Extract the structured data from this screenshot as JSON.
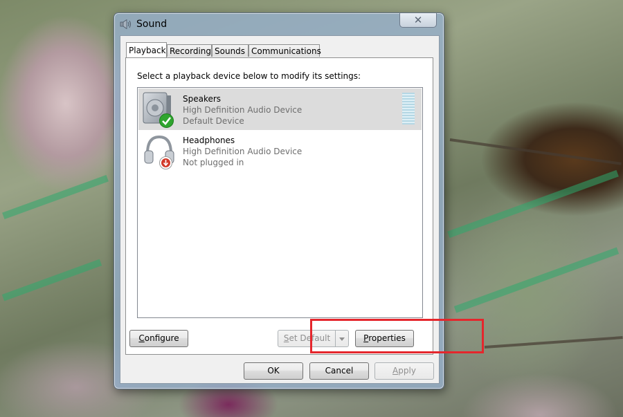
{
  "window": {
    "title": "Sound",
    "close_glyph": "✕"
  },
  "tabs": [
    {
      "label": "Playback",
      "active": true
    },
    {
      "label": "Recording",
      "active": false
    },
    {
      "label": "Sounds",
      "active": false
    },
    {
      "label": "Communications",
      "active": false
    }
  ],
  "playback": {
    "instruction": "Select a playback device below to modify its settings:",
    "devices": [
      {
        "name": "Speakers",
        "description": "High Definition Audio Device",
        "status": "Default Device",
        "icon": "speaker-icon",
        "status_icon": "green-check-icon",
        "selected": true
      },
      {
        "name": "Headphones",
        "description": "High Definition Audio Device",
        "status": "Not plugged in",
        "icon": "headphones-icon",
        "status_icon": "red-down-arrow-icon",
        "selected": false
      }
    ]
  },
  "buttons": {
    "configure": {
      "pre": "",
      "u": "C",
      "post": "onfigure"
    },
    "set_default": {
      "pre": "",
      "u": "S",
      "post": "et Default"
    },
    "properties": {
      "pre": "",
      "u": "P",
      "post": "roperties"
    },
    "ok": "OK",
    "cancel": "Cancel",
    "apply": {
      "pre": "",
      "u": "A",
      "post": "pply"
    }
  },
  "colors": {
    "highlight": "#e5262c",
    "selected_row": "#dcdcdc",
    "secondary_text": "#6d6d6d",
    "check_green": "#2fa52f",
    "warning_red": "#d23a2a"
  }
}
